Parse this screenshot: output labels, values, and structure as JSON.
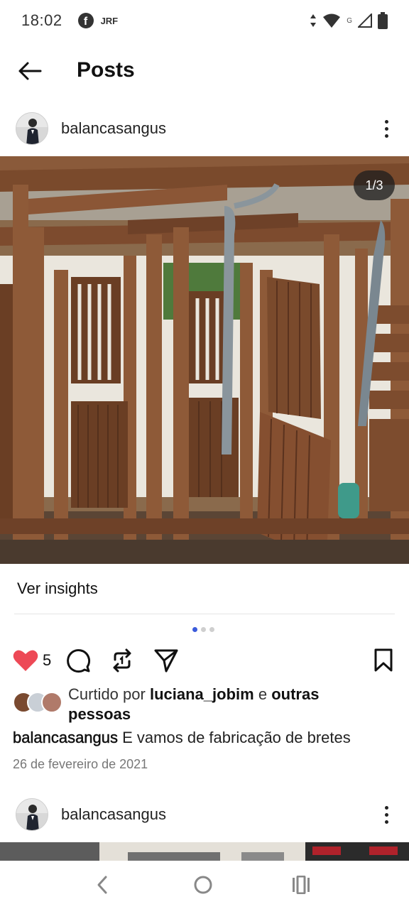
{
  "status_bar": {
    "time": "18:02",
    "facebook_icon_letter": "f",
    "notification_label": "JRF",
    "signal_label": "G",
    "icons": [
      "facebook-icon",
      "data-arrows-icon",
      "wifi-icon",
      "signal-icon",
      "battery-icon"
    ]
  },
  "app_bar": {
    "title": "Posts",
    "back_icon": "arrow-left-icon"
  },
  "post": {
    "username": "balancasangus",
    "more_icon": "more-vertical-icon",
    "image_counter": "1/3",
    "insights_label": "Ver insights",
    "carousel": {
      "total": 3,
      "active_index": 0
    },
    "like_count": "5",
    "liked_prefix": "Curtido por",
    "liked_user": "luciana_jobim",
    "liked_joiner": "e",
    "liked_others": "outras",
    "liked_others_2": "pessoas",
    "caption_user": "balancasangus",
    "caption_text": "E vamos de fabricação de bretes",
    "date": "26 de fevereiro de 2021",
    "colors": {
      "like_heart": "#ed4956",
      "carousel_active": "#3b5bdb"
    }
  },
  "next_post": {
    "username": "balancasangus"
  },
  "nav_bar": {
    "icons": [
      "nav-back-icon",
      "home-circle-icon",
      "recent-apps-icon"
    ]
  }
}
